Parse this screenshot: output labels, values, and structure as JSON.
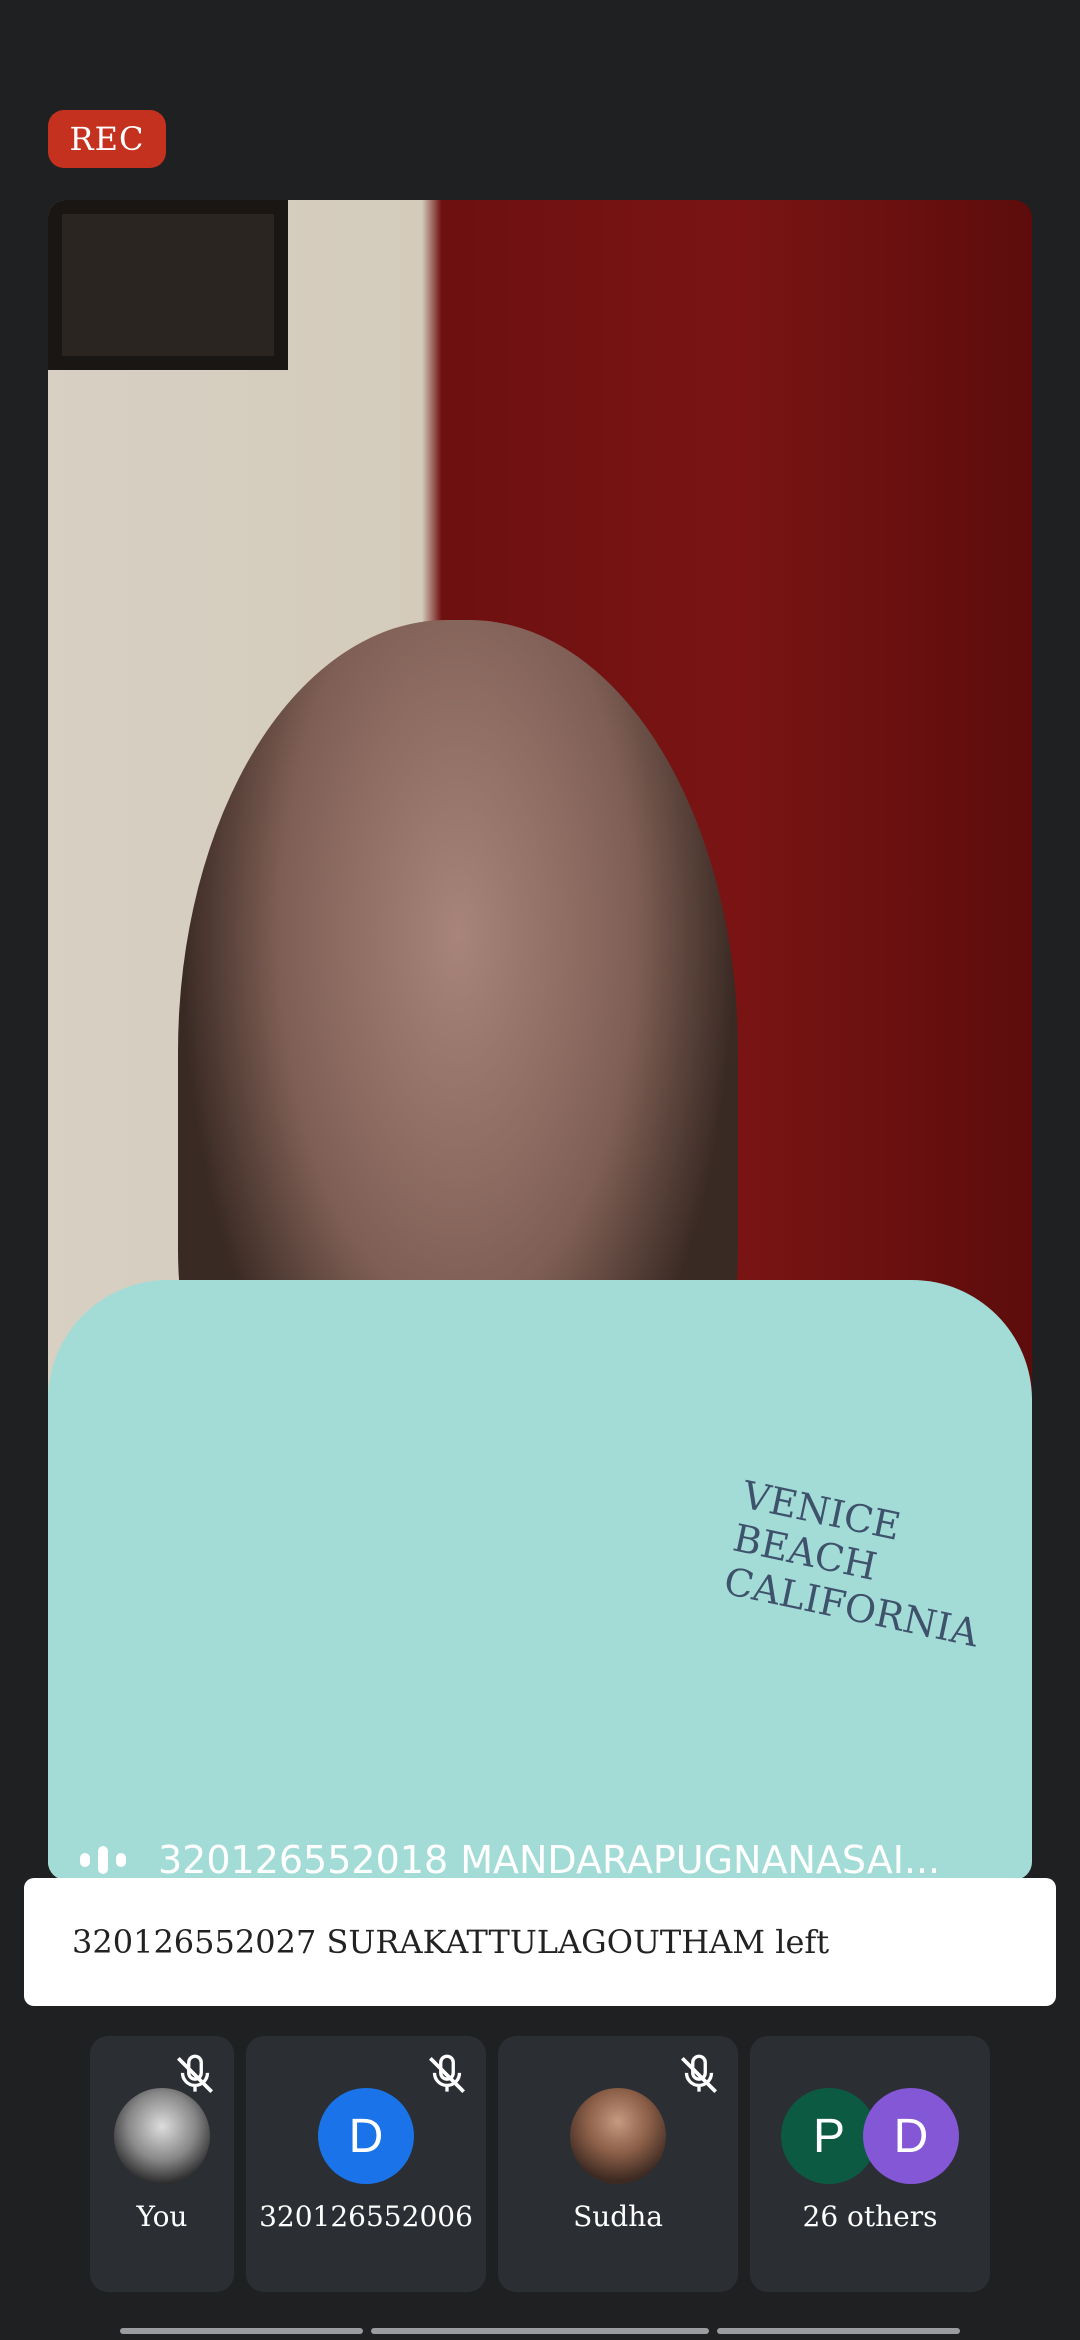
{
  "recording_badge": "REC",
  "active_speaker": {
    "name": "320126552018 MANDARAPUGNANASAI..."
  },
  "video_shirt_text": "VENICE BEACH CALIFORNIA",
  "toast": {
    "message": "320126552027 SURAKATTULAGOUTHAM left"
  },
  "participants": [
    {
      "name": "You",
      "muted": true
    },
    {
      "name": "320126552006",
      "initial": "D",
      "color": "#1a73e8",
      "muted": true
    },
    {
      "name": "Sudha",
      "muted": true
    },
    {
      "name": "26 others",
      "initials": [
        "P",
        "D"
      ],
      "colors": [
        "#0d5a43",
        "#8357d6"
      ]
    }
  ],
  "colors": {
    "background": "#1f2022",
    "rec": "#c5311f",
    "tile": "#2b2e33"
  }
}
